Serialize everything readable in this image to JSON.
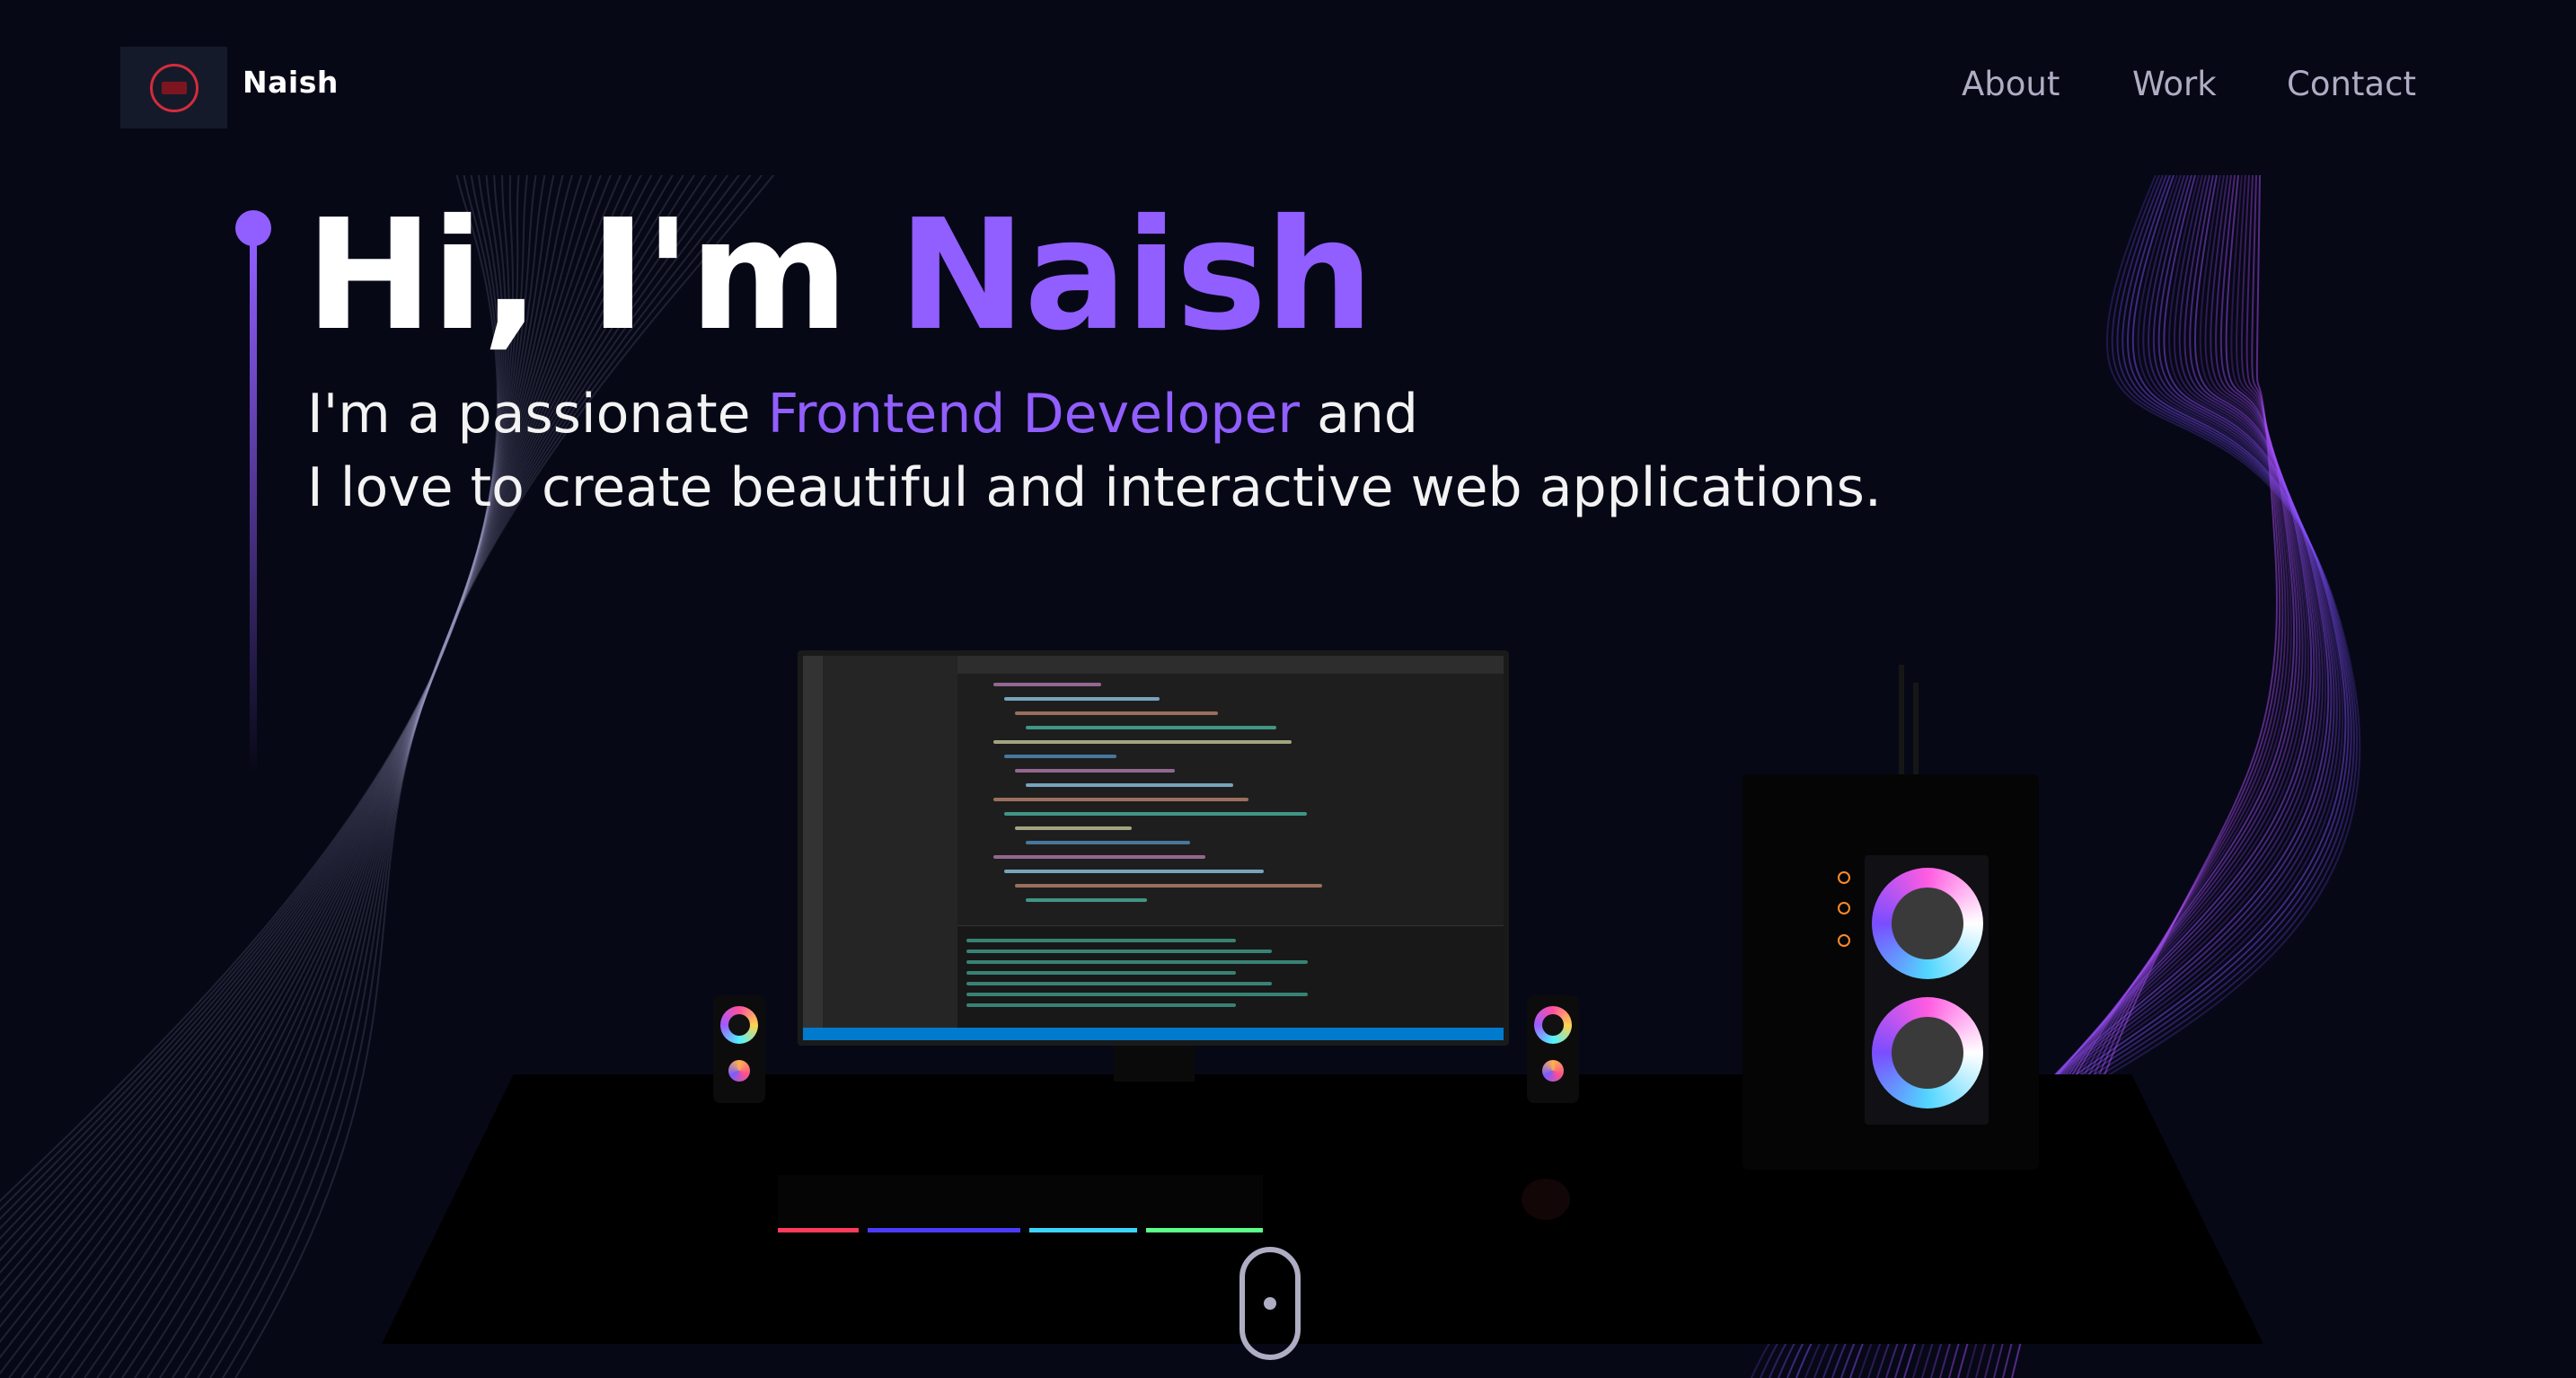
{
  "nav": {
    "brand": "Naish",
    "links": [
      "About",
      "Work",
      "Contact"
    ]
  },
  "hero": {
    "greeting": "Hi, I'm ",
    "name": "Naish",
    "line1_prefix": "I'm a passionate ",
    "line1_role": "Frontend Developer",
    "line1_suffix": " and",
    "line2": "I love to create beautiful and interactive web applications."
  },
  "colors": {
    "background": "#070816",
    "accent": "#915eff",
    "nav_text": "#aeadc3"
  },
  "icons": {
    "logo": "logo-icon",
    "scroll": "scroll-down-icon"
  }
}
